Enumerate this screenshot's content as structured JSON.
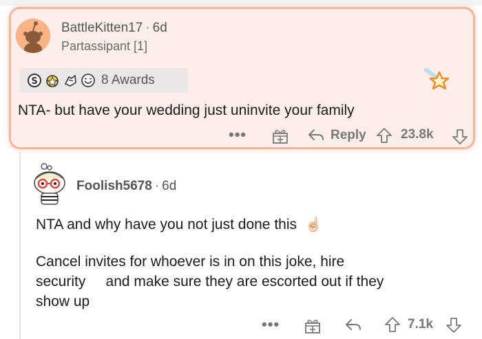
{
  "comment1": {
    "username": "BattleKitten17",
    "time": "6d",
    "flair": "Partassipant [1]",
    "awards_label": "8 Awards",
    "body": "NTA- but have your wedding just uninvite your family",
    "reply_label": "Reply",
    "score": "23.8k",
    "more": "•••"
  },
  "comment2": {
    "username": "Foolish5678",
    "time": "6d",
    "body_line1": "NTA and why have you not just done this",
    "body_emoji": "☝🏻",
    "body_para2": "Cancel invites for whoever is in on this joke, hire\nsecurity     and make sure they are escorted out if they\nshow up",
    "score": "7.1k",
    "more": "•••"
  },
  "colors": {
    "highlight_bg": "#fdeee9",
    "highlight_border": "#f6b49a",
    "meta_text": "#555555",
    "icon_gray": "#777777"
  }
}
